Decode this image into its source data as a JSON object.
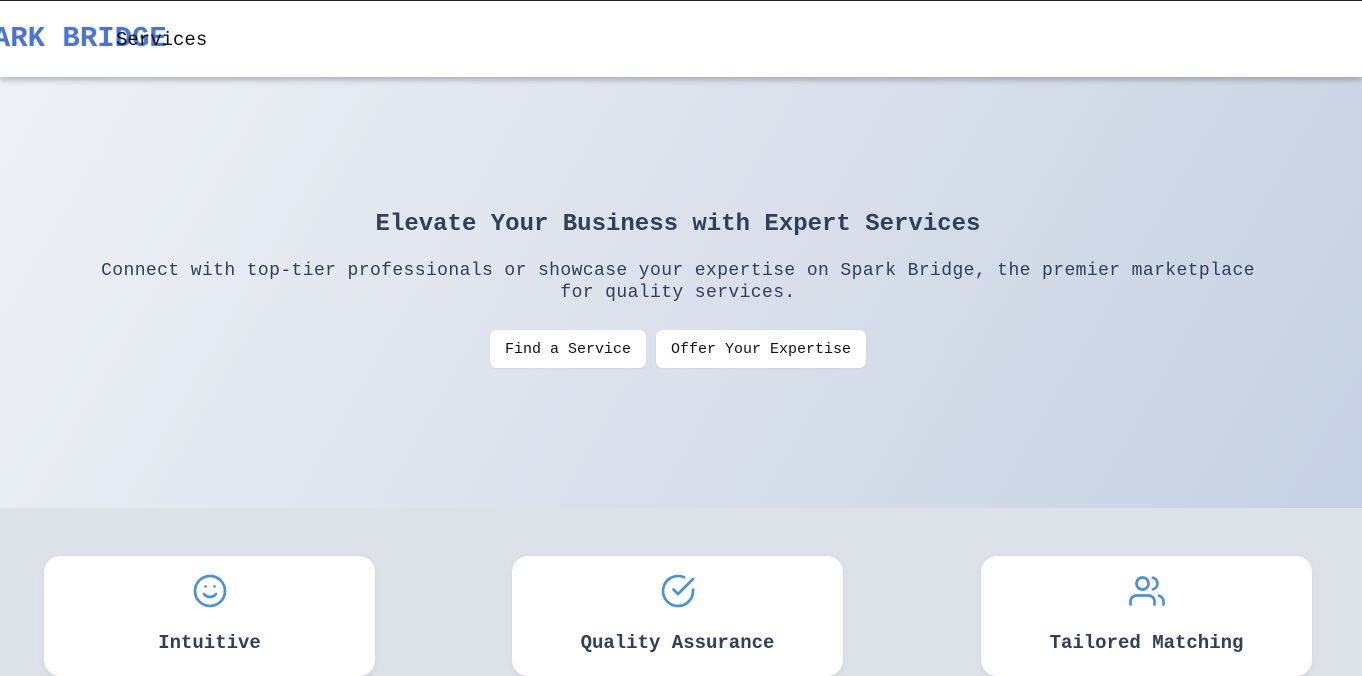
{
  "header": {
    "logo_text": "SPARK BRIDGE",
    "nav_services": "Services"
  },
  "hero": {
    "title": "Elevate Your Business with Expert Services",
    "subtitle": "Connect with top-tier professionals or showcase your expertise on Spark Bridge, the premier marketplace for quality services.",
    "primary_button": "Find a Service",
    "secondary_button": "Offer Your Expertise"
  },
  "features": [
    {
      "icon": "smile-icon",
      "title": "Intuitive"
    },
    {
      "icon": "check-circle-icon",
      "title": "Quality Assurance"
    },
    {
      "icon": "users-icon",
      "title": "Tailored Matching"
    }
  ],
  "colors": {
    "accent": "#4a74dc",
    "icon": "#4a90e2",
    "heading": "#2f4058"
  }
}
